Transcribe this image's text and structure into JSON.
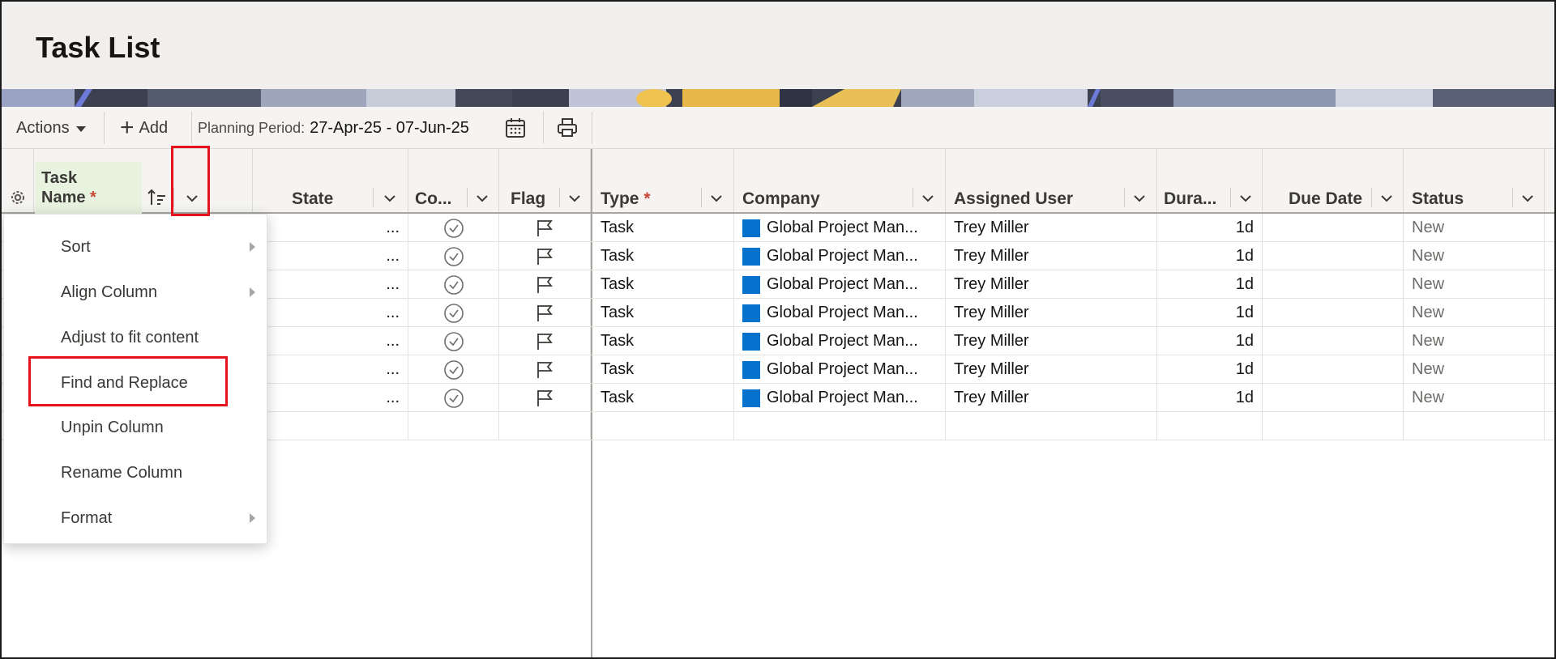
{
  "page": {
    "title": "Task List"
  },
  "toolbar": {
    "actions_label": "Actions",
    "add_label": "Add",
    "planning_period_label": "Planning Period:",
    "planning_period_value": "27-Apr-25 - 07-Jun-25"
  },
  "columns": {
    "task_name_line1": "Task",
    "task_name_line2": "Name",
    "required_mark": "*",
    "state": "State",
    "complete": "Co...",
    "flag": "Flag",
    "type": "Type",
    "company": "Company",
    "assigned_user": "Assigned User",
    "duration": "Dura...",
    "due_date": "Due Date",
    "status": "Status"
  },
  "rows": [
    {
      "state": "...",
      "type": "Task",
      "company": "Global Project Man...",
      "assigned_user": "Trey Miller",
      "duration": "1d",
      "due_date": "",
      "status": "New"
    },
    {
      "state": "...",
      "type": "Task",
      "company": "Global Project Man...",
      "assigned_user": "Trey Miller",
      "duration": "1d",
      "due_date": "",
      "status": "New"
    },
    {
      "state": "...",
      "type": "Task",
      "company": "Global Project Man...",
      "assigned_user": "Trey Miller",
      "duration": "1d",
      "due_date": "",
      "status": "New"
    },
    {
      "state": "...",
      "type": "Task",
      "company": "Global Project Man...",
      "assigned_user": "Trey Miller",
      "duration": "1d",
      "due_date": "",
      "status": "New"
    },
    {
      "state": "...",
      "type": "Task",
      "company": "Global Project Man...",
      "assigned_user": "Trey Miller",
      "duration": "1d",
      "due_date": "",
      "status": "New"
    },
    {
      "state": "...",
      "type": "Task",
      "company": "Global Project Man...",
      "assigned_user": "Trey Miller",
      "duration": "1d",
      "due_date": "",
      "status": "New"
    },
    {
      "state": "...",
      "type": "Task",
      "company": "Global Project Man...",
      "assigned_user": "Trey Miller",
      "duration": "1d",
      "due_date": "",
      "status": "New"
    }
  ],
  "context_menu": {
    "items": [
      {
        "label": "Sort",
        "has_submenu": true
      },
      {
        "label": "Align Column",
        "has_submenu": true
      },
      {
        "label": "Adjust to fit content",
        "has_submenu": false
      },
      {
        "label": "Find and Replace",
        "has_submenu": false
      },
      {
        "label": "Unpin Column",
        "has_submenu": false
      },
      {
        "label": "Rename Column",
        "has_submenu": false
      },
      {
        "label": "Format",
        "has_submenu": true
      }
    ]
  },
  "colors": {
    "accent_highlight": "#e8121c",
    "company_square": "#0572ce",
    "task_header_bg": "#e7f3df",
    "required_mark": "#c74634"
  },
  "icons": [
    "gear-icon",
    "sort-icon",
    "chevron-down-icon",
    "plus-icon",
    "calendar-icon",
    "print-icon",
    "check-circle-icon",
    "flag-icon",
    "caret-right-icon"
  ]
}
